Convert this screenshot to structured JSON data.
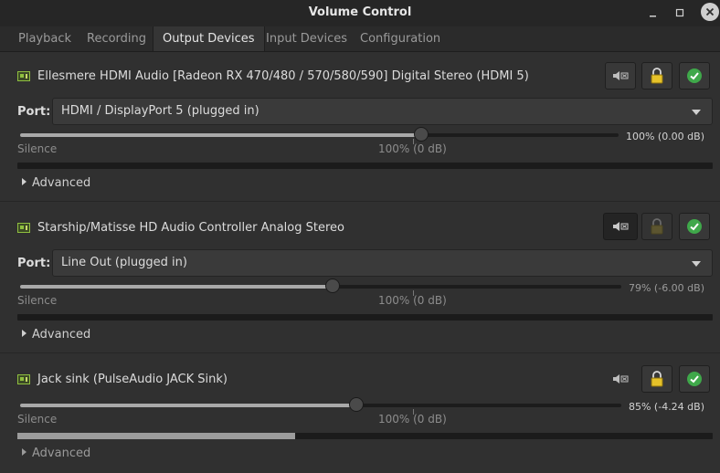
{
  "window": {
    "title": "Volume Control"
  },
  "tabs": [
    {
      "label": "Playback"
    },
    {
      "label": "Recording"
    },
    {
      "label": "Output Devices",
      "active": true
    },
    {
      "label": "Input Devices"
    },
    {
      "label": "Configuration"
    }
  ],
  "devices": [
    {
      "name": "Ellesmere HDMI Audio [Radeon RX 470/480 / 570/580/590] Digital Stereo (HDMI 5)",
      "port_label": "Port:",
      "port_value": "HDMI / DisplayPort 5 (plugged in)",
      "volume_text": "100% (0.00 dB)",
      "volume_fraction": 0.67,
      "silence_label": "Silence",
      "ref_label": "100% (0 dB)",
      "meter_level": 0,
      "advanced_label": "Advanced",
      "mute_pressed": false,
      "lock_active": true
    },
    {
      "name": "Starship/Matisse HD Audio Controller Analog Stereo",
      "port_label": "Port:",
      "port_value": "Line Out (plugged in)",
      "volume_text": "79% (-6.00 dB)",
      "volume_fraction": 0.52,
      "silence_label": "Silence",
      "ref_label": "100% (0 dB)",
      "meter_level": 0,
      "advanced_label": "Advanced",
      "mute_pressed": true,
      "lock_active": false
    },
    {
      "name": "Jack sink (PulseAudio JACK Sink)",
      "volume_text": "85% (-4.24 dB)",
      "volume_fraction": 0.56,
      "silence_label": "Silence",
      "ref_label": "100% (0 dB)",
      "meter_level": 0.4,
      "advanced_label": "Advanced",
      "mute_pressed": false,
      "lock_active": true
    }
  ],
  "colors": {
    "accent_green": "#3fa84a",
    "lock_yellow": "#e6c229",
    "device_icon": "#8fbf3f"
  }
}
